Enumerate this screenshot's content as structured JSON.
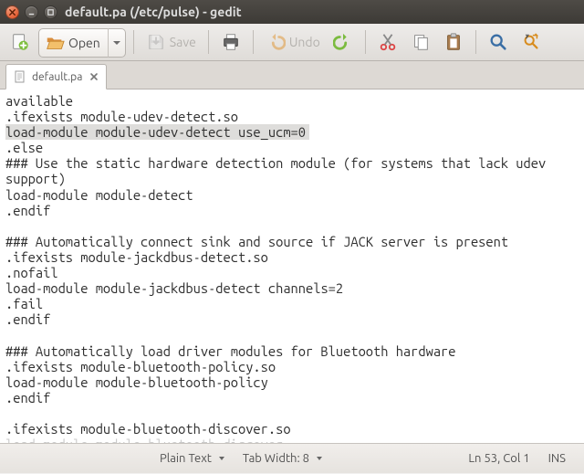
{
  "window": {
    "title": "default.pa (/etc/pulse) - gedit"
  },
  "toolbar": {
    "open_label": "Open",
    "save_label": "Save",
    "undo_label": "Undo"
  },
  "tab": {
    "label": "default.pa"
  },
  "editor": {
    "line01": "available",
    "line02": ".ifexists module-udev-detect.so",
    "line03_hl": "load-module module-udev-detect use_ucm=0",
    "line04": ".else",
    "line05": "### Use the static hardware detection module (for systems that lack udev support)",
    "line06": "load-module module-detect",
    "line07": ".endif",
    "line08": "",
    "line09": "### Automatically connect sink and source if JACK server is present",
    "line10": ".ifexists module-jackdbus-detect.so",
    "line11": ".nofail",
    "line12": "load-module module-jackdbus-detect channels=2",
    "line13": ".fail",
    "line14": ".endif",
    "line15": "",
    "line16": "### Automatically load driver modules for Bluetooth hardware",
    "line17": ".ifexists module-bluetooth-policy.so",
    "line18": "load-module module-bluetooth-policy",
    "line19": ".endif",
    "line20": "",
    "line21": ".ifexists module-bluetooth-discover.so",
    "line22_cut": "load-module module-bluetooth-discover"
  },
  "statusbar": {
    "syntax_label": "Plain Text",
    "tab_width_label": "Tab Width: 8",
    "position": "Ln 53, Col 1",
    "insert_mode": "INS"
  }
}
